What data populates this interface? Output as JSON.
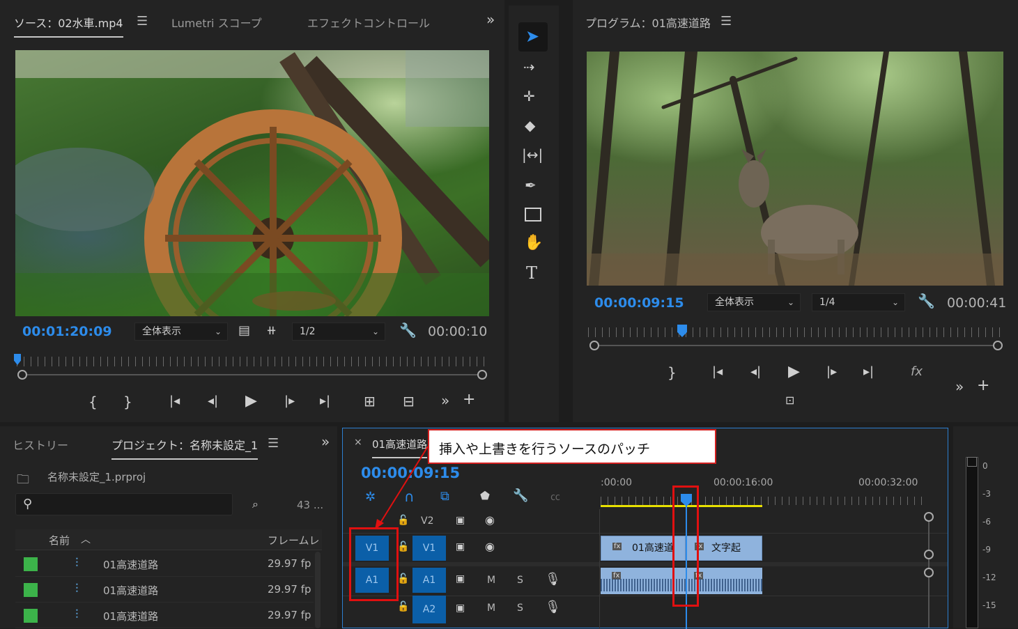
{
  "source_panel": {
    "tabs": [
      "ソース：02水車.mp4",
      "Lumetri スコープ",
      "エフェクトコントロール"
    ],
    "menu_icon": "hamburger-icon",
    "overflow_icon": "double-chevron-right-icon",
    "timecode": "00:01:20:09",
    "fit_dropdown": "全体表示",
    "resolution_dropdown": "1/2",
    "duration": "00:00:10"
  },
  "program_panel": {
    "title": "プログラム：01高速道路",
    "menu_icon": "hamburger-icon",
    "timecode": "00:00:09:15",
    "fit_dropdown": "全体表示",
    "resolution_dropdown": "1/4",
    "duration": "00:00:41"
  },
  "tools": [
    "selection-tool",
    "track-select-tool",
    "ripple-edit-tool",
    "razor-tool",
    "slip-tool",
    "pen-tool",
    "rectangle-tool",
    "hand-tool",
    "type-tool"
  ],
  "project_panel": {
    "tabs": [
      "ヒストリー",
      "プロジェクト：名称未設定_1"
    ],
    "project_file": "名称未設定_1.prproj",
    "item_count": "43 ...",
    "col_name": "名前",
    "col_framerate": "フレームレ",
    "rows": [
      {
        "name": "01高速道路",
        "fps": "29.97 fp",
        "color": "#3cb34a"
      },
      {
        "name": "01高速道路",
        "fps": "29.97 fp",
        "color": "#3cb34a"
      },
      {
        "name": "01高速道路",
        "fps": "29.97 fp",
        "color": "#3cb34a"
      }
    ]
  },
  "timeline": {
    "sequence_tab": "01高速道路",
    "close": "×",
    "timecode": "00:00:09:15",
    "ruler_labels": [
      ":00:00",
      "00:00:16:00",
      "00:00:32:00"
    ],
    "tracks": {
      "v2": "V2",
      "v1_source": "V1",
      "v1": "V1",
      "a1_source": "A1",
      "a1": "A1",
      "a2": "A2",
      "mute": "M",
      "solo": "S"
    },
    "clips": {
      "video_clip_1": "01高速道",
      "video_clip_2": "文字起",
      "fx_badge": "fx"
    }
  },
  "callout": {
    "text": "挿入や上書きを行うソースのパッチ"
  },
  "audio_meter": {
    "labels": [
      "0",
      "-3",
      "-6",
      "-9",
      "-12",
      "-15"
    ]
  },
  "colors": {
    "accent_blue": "#2d8ceb",
    "patch_blue": "#0b5fa8",
    "clip_blue": "#8fb3dd",
    "highlight_red": "#e01010",
    "work_area_yellow": "#e8e000"
  }
}
